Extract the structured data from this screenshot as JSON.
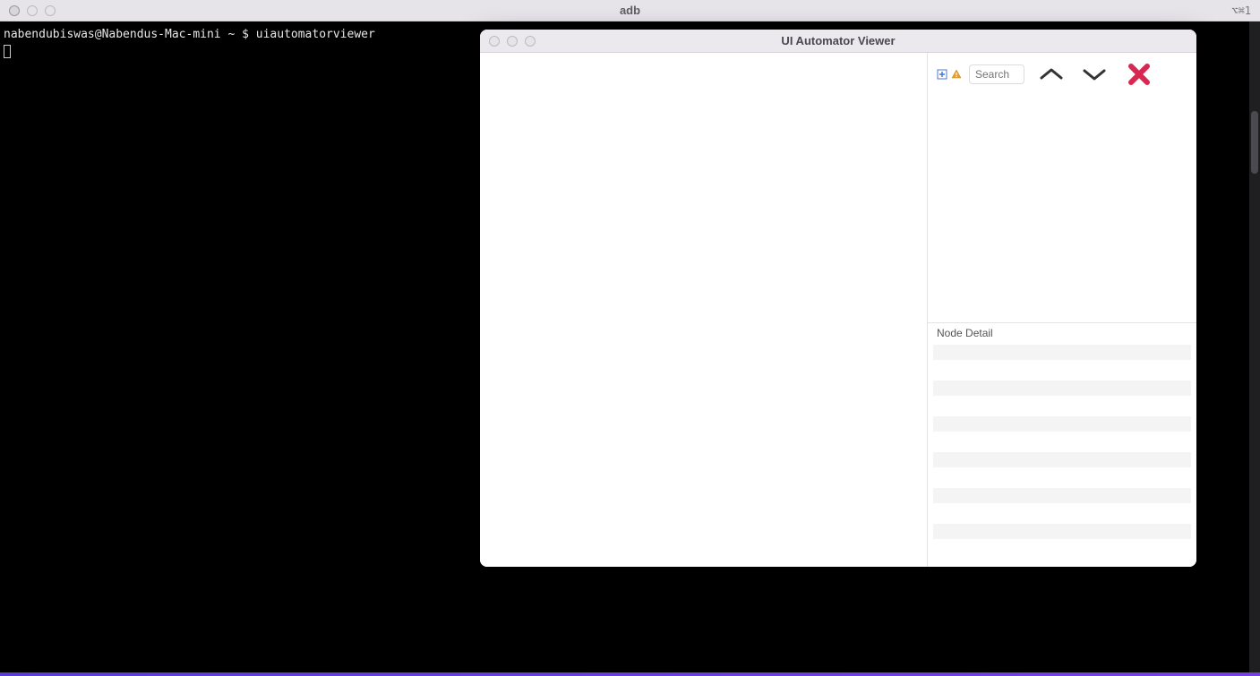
{
  "top": {
    "title": "adb",
    "indicator": "⌥⌘1"
  },
  "terminal": {
    "prompt": "nabendubiswas@Nabendus-Mac-mini ~ $ ",
    "command": "uiautomatorviewer"
  },
  "viewer": {
    "title": "UI Automator Viewer",
    "search_placeholder": "Search",
    "node_detail_label": "Node Detail",
    "detail_row_count": 12
  }
}
